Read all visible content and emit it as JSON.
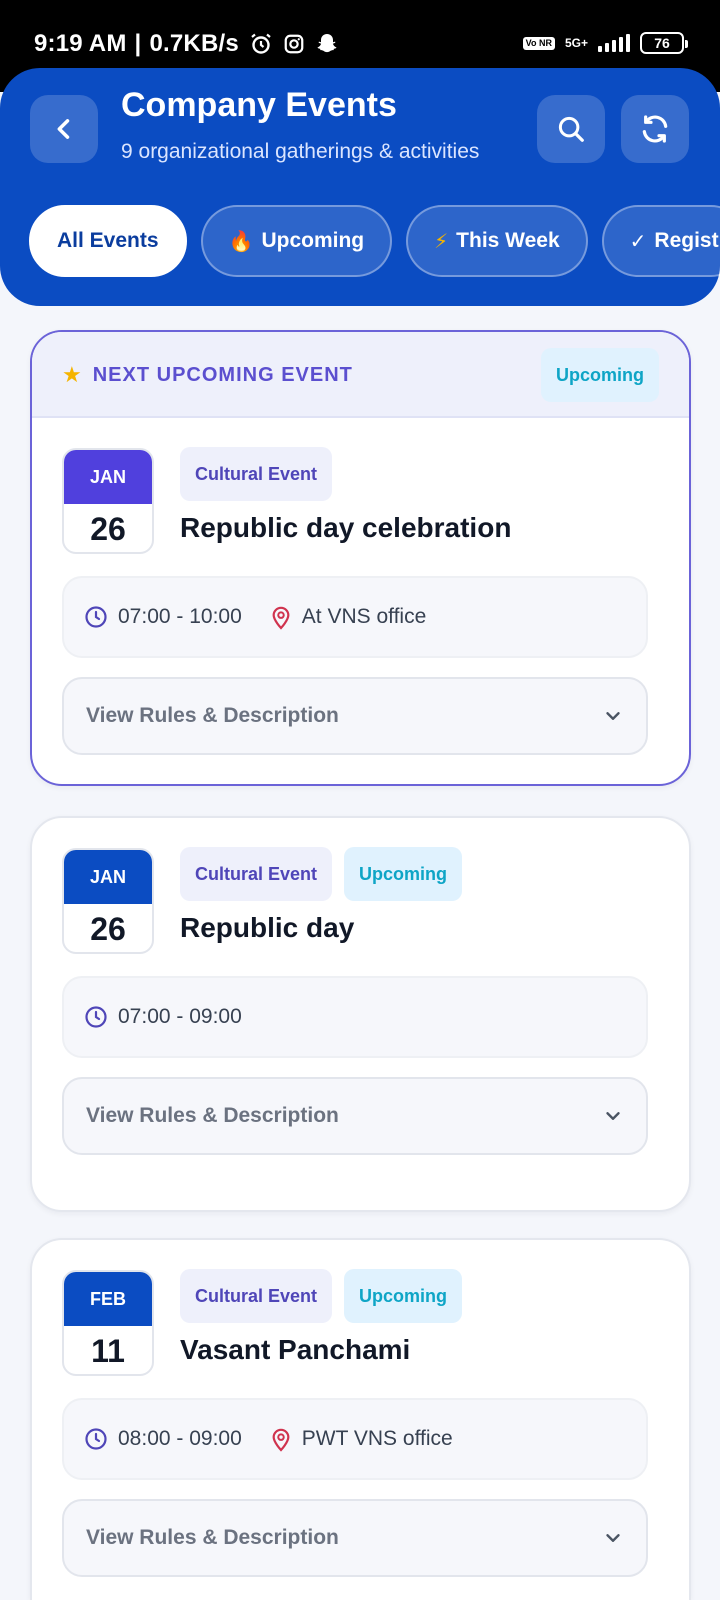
{
  "status_bar": {
    "time": "9:19 AM",
    "speed": "0.7KB/s",
    "volte": "Vo NR",
    "network": "5G+",
    "battery": "76"
  },
  "header": {
    "title": "Company Events",
    "subtitle": "9 organizational gatherings & activities",
    "tabs": [
      {
        "emoji": "",
        "label": "All Events"
      },
      {
        "emoji": "🔥",
        "label": "Upcoming"
      },
      {
        "emoji": "⚡",
        "label": "This Week"
      },
      {
        "emoji": "✓",
        "label": "Regist"
      }
    ]
  },
  "featured": {
    "label": "NEXT UPCOMING EVENT",
    "status": "Upcoming"
  },
  "events": [
    {
      "month": "JAN",
      "day": "26",
      "category": "Cultural Event",
      "status": "",
      "title": "Republic day celebration",
      "time": "07:00 - 10:00",
      "location": "At VNS office",
      "rules_label": "View Rules & Description"
    },
    {
      "month": "JAN",
      "day": "26",
      "category": "Cultural Event",
      "status": "Upcoming",
      "title": "Republic day",
      "time": "07:00 - 09:00",
      "location": "",
      "rules_label": "View Rules & Description"
    },
    {
      "month": "FEB",
      "day": "11",
      "category": "Cultural Event",
      "status": "Upcoming",
      "title": "Vasant Panchami",
      "time": "08:00 - 09:00",
      "location": "PWT VNS office",
      "rules_label": "View Rules & Description"
    }
  ],
  "colors": {
    "brand": "#0b4cc2",
    "featured_accent": "#5040dd",
    "status_text": "#0ea5c6",
    "location_icon": "#d0334e",
    "clock_icon": "#4f46b8"
  }
}
